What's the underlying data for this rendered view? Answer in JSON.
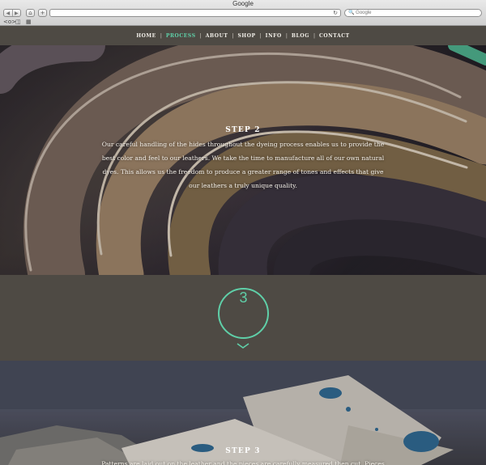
{
  "browser": {
    "title": "Google",
    "search_placeholder": "Google",
    "nav_back": "◀",
    "nav_forward": "▶",
    "home_icon": "⌂",
    "add_icon": "+",
    "reload_icon": "↻",
    "search_icon": "🔍",
    "bookmark_icons": [
      "reader-icon",
      "book-icon",
      "grid-icon"
    ]
  },
  "nav": {
    "items": [
      {
        "label": "HOME"
      },
      {
        "label": "PROCESS"
      },
      {
        "label": "ABOUT"
      },
      {
        "label": "SHOP"
      },
      {
        "label": "INFO"
      },
      {
        "label": "BLOG"
      },
      {
        "label": "CONTACT"
      }
    ],
    "active_index": 1
  },
  "step2": {
    "title": "STEP 2",
    "text": "Our careful handling of the hides throughout the dyeing process enables us to provide the best color and feel to our leathers. We take the time to manufacture all of our own natural dyes. This allows us the freedom to produce a greater range of tones and effects that give our leathers a truly unique quality."
  },
  "step3_marker": {
    "number": "3"
  },
  "step3": {
    "title": "STEP 3",
    "text": "Patterns are laid out on the leather and the pieces are carefully measured then cut. Pieces"
  },
  "colors": {
    "accent": "#5fcfa8",
    "band": "#4e4a44"
  }
}
